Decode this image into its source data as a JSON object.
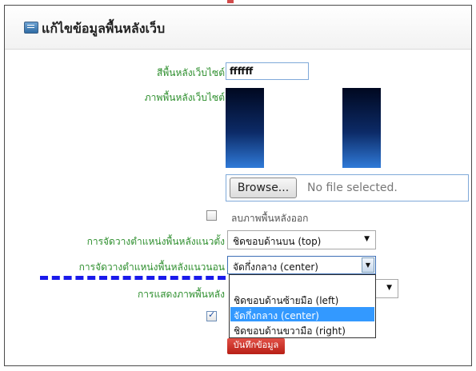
{
  "header": {
    "title": "แก้ไขข้อมูลพื้นหลังเว็บ",
    "icon": "monitor-icon"
  },
  "form": {
    "bg_color_label": "สีพื้นหลังเว็บไซต์",
    "bg_color_value": "ffffff",
    "bg_image_label": "ภาพพื้นหลังเว็บไซต์",
    "browse_label": "Browse...",
    "file_status": "No file selected.",
    "remove_bg_label": "ลบภาพพื้นหลังออก",
    "vertical_label": "การจัดวางตำแหน่งพื้นหลังแนวตั้ง",
    "vertical_value": "ชิดขอบด้านบน (top)",
    "horizontal_label": "การจัดวางตำแหน่งพื้นหลังแนวนอน",
    "horizontal_value": "จัดกึ่งกลาง (center)",
    "display_label": "การแสดงภาพพื้นหลัง",
    "save_label": "บันทึกข้อมูล"
  },
  "horizontal_options": [
    "ชิดขอบด้านซ้ายมือ (left)",
    "จัดกึ่งกลาง (center)",
    "ชิดขอบด้านขวามือ (right)"
  ],
  "state": {
    "remove_bg_checked": false,
    "display_checked": true,
    "selected_horizontal_index": 1
  },
  "colors": {
    "label_green": "#2e8f2e",
    "selection_blue": "#3399ff",
    "save_red": "#c8291f",
    "annotation_blue": "#1a1aeb"
  }
}
